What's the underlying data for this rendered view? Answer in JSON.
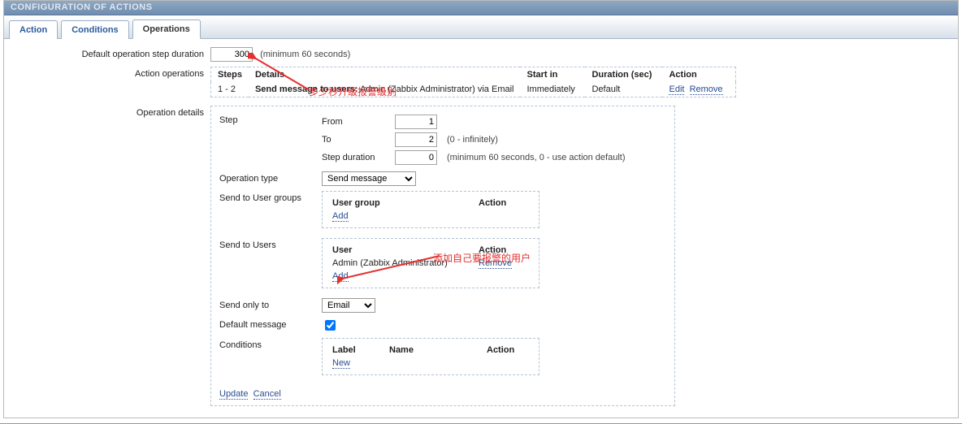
{
  "header": "CONFIGURATION OF ACTIONS",
  "tabs": {
    "action": "Action",
    "conditions": "Conditions",
    "operations": "Operations"
  },
  "form": {
    "default_step_duration_label": "Default operation step duration",
    "default_step_duration_value": "300",
    "default_step_duration_hint": "(minimum 60 seconds)",
    "action_operations_label": "Action operations",
    "operation_details_label": "Operation details"
  },
  "ops_table": {
    "headers": {
      "steps": "Steps",
      "details": "Details",
      "start_in": "Start in",
      "duration": "Duration (sec)",
      "action": "Action"
    },
    "row1": {
      "steps": "1 - 2",
      "details_prefix": "Send message to users:",
      "details_rest": " Admin (Zabbix Administrator) via Email",
      "start_in": "Immediately",
      "duration": "Default",
      "edit": "Edit",
      "remove": "Remove"
    }
  },
  "details": {
    "step_label": "Step",
    "from_label": "From",
    "from_value": "1",
    "to_label": "To",
    "to_value": "2",
    "to_hint": "(0 - infinitely)",
    "step_duration_label": "Step duration",
    "step_duration_value": "0",
    "step_duration_hint": "(minimum 60 seconds, 0 - use action default)",
    "operation_type_label": "Operation type",
    "operation_type_value": "Send message",
    "send_to_user_groups_label": "Send to User groups",
    "user_group_box": {
      "col1": "User group",
      "col2": "Action",
      "add": "Add"
    },
    "send_to_users_label": "Send to Users",
    "users_box": {
      "col1": "User",
      "col2": "Action",
      "row_user": "Admin (Zabbix Administrator)",
      "row_remove": "Remove",
      "add": "Add"
    },
    "send_only_to_label": "Send only to",
    "send_only_to_value": "Email",
    "default_message_label": "Default message",
    "conditions_label": "Conditions",
    "conditions_box": {
      "col1": "Label",
      "col2": "Name",
      "col3": "Action",
      "new": "New"
    },
    "update": "Update",
    "cancel": "Cancel"
  },
  "annotations": {
    "note1": "多少秒升级报警级别",
    "note2": "添加自己要报警的用户"
  }
}
